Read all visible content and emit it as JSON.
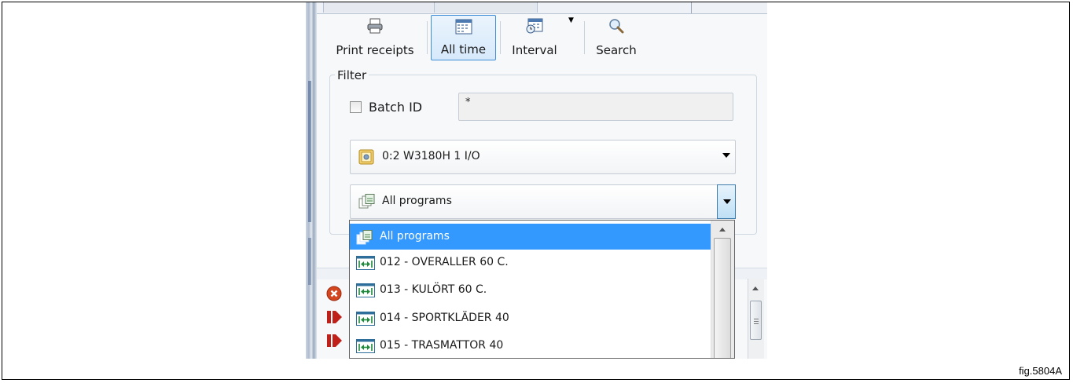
{
  "figure_label": "fig.5804A",
  "toolbar": {
    "print_receipts": "Print receipts",
    "all_time": "All time",
    "interval": "Interval",
    "search": "Search"
  },
  "filter": {
    "legend": "Filter",
    "batch_id_label": "Batch ID",
    "batch_id_checked": false,
    "batch_id_value": "*",
    "machine_combo": "0:2 W3180H 1 I/O",
    "program_combo": "All programs"
  },
  "program_dropdown": {
    "items": [
      {
        "label": "All programs",
        "icon": "all-programs-icon",
        "selected": true
      },
      {
        "label": "012 - OVERALLER 60 C.",
        "icon": "program-icon",
        "selected": false
      },
      {
        "label": "013 - KULÖRT 60 C.",
        "icon": "program-icon",
        "selected": false
      },
      {
        "label": "014 - SPORTKLÄDER 40",
        "icon": "program-icon",
        "selected": false
      },
      {
        "label": "015 - TRASMATTOR 40",
        "icon": "program-icon",
        "selected": false
      }
    ]
  },
  "colors": {
    "selection": "#3399ff",
    "active_button_border": "#3e8ed8",
    "error_icon": "#d4461f",
    "stop_icon": "#c0201a"
  }
}
